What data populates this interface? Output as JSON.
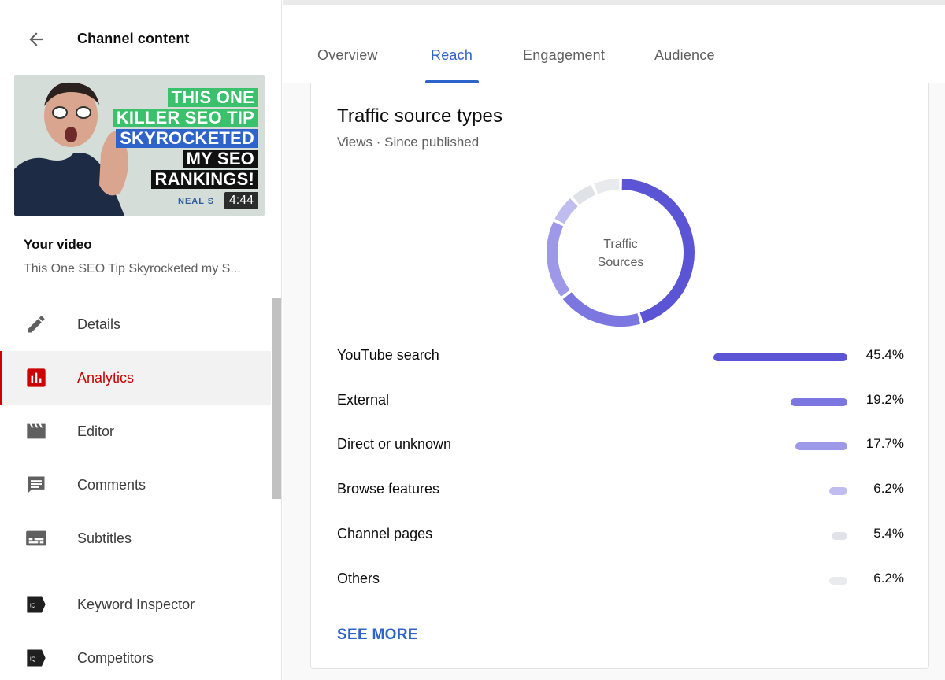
{
  "sidebar": {
    "title": "Channel content",
    "back_icon": "arrow-back-icon",
    "thumbnail": {
      "lines": [
        "THIS ONE",
        "KILLER SEO TIP",
        "SKYROCKETED",
        "MY SEO",
        "RANKINGS!"
      ],
      "logo": "NEAL S",
      "duration": "4:44"
    },
    "your_video_label": "Your video",
    "video_title": "This One SEO Tip Skyrocketed my S...",
    "items": [
      {
        "label": "Details",
        "icon": "pencil-icon",
        "active": false
      },
      {
        "label": "Analytics",
        "icon": "analytics-icon",
        "active": true
      },
      {
        "label": "Editor",
        "icon": "clapperboard-icon",
        "active": false
      },
      {
        "label": "Comments",
        "icon": "comment-icon",
        "active": false
      },
      {
        "label": "Subtitles",
        "icon": "subtitles-icon",
        "active": false
      },
      {
        "label": "Keyword Inspector",
        "icon": "vidiq-icon",
        "active": false
      },
      {
        "label": "Competitors",
        "icon": "vidiq-icon",
        "active": false
      }
    ]
  },
  "tabs": [
    {
      "label": "Overview",
      "active": false
    },
    {
      "label": "Reach",
      "active": true
    },
    {
      "label": "Engagement",
      "active": false
    },
    {
      "label": "Audience",
      "active": false
    }
  ],
  "card": {
    "title": "Traffic source types",
    "subtitle": "Views · Since published",
    "donut_label_line1": "Traffic",
    "donut_label_line2": "Sources",
    "see_more": "SEE MORE"
  },
  "chart_data": {
    "type": "pie",
    "title": "Traffic source types",
    "subtitle": "Views · Since published",
    "categories": [
      "YouTube search",
      "External",
      "Direct or unknown",
      "Browse features",
      "Channel pages",
      "Others"
    ],
    "values": [
      45.4,
      19.2,
      17.7,
      6.2,
      5.4,
      6.2
    ],
    "value_labels": [
      "45.4%",
      "19.2%",
      "17.7%",
      "6.2%",
      "5.4%",
      "6.2%"
    ],
    "colors": [
      "#5b55d6",
      "#7b76e0",
      "#9d99e8",
      "#bfbdf0",
      "#dfe3e8",
      "#e8eaed"
    ],
    "unit": "%"
  },
  "colors": {
    "accent": "#2e63c9",
    "active_nav": "#cc0000"
  }
}
